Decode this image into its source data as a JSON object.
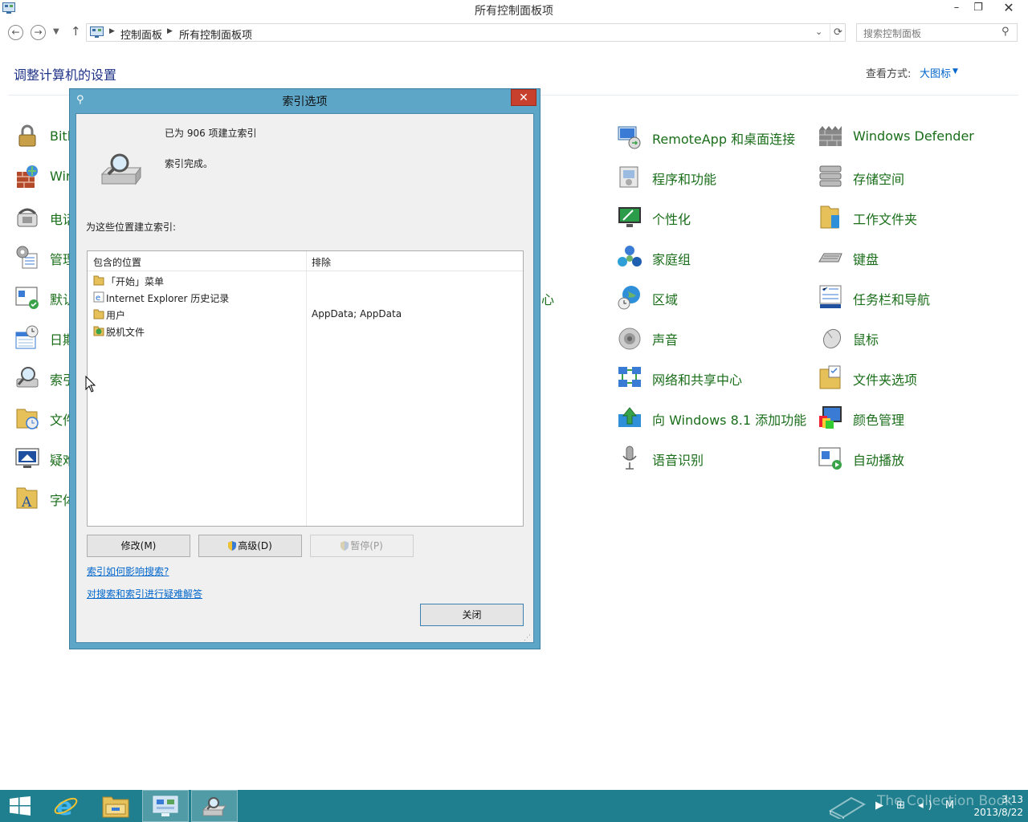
{
  "window": {
    "title": "所有控制面板项",
    "minimize": "–",
    "maximize": "❐",
    "close": "✕"
  },
  "nav": {
    "back": "←",
    "forward": "→",
    "recent": "▼",
    "up": "↑",
    "breadcrumb": [
      "控制面板",
      "所有控制面板项"
    ],
    "refresh": "⟳",
    "search_placeholder": "搜索控制面板"
  },
  "page": {
    "heading": "调整计算机的设置",
    "view_by_label": "查看方式:",
    "view_by_value": "大图标"
  },
  "left_column_partial": [
    "Bitl",
    "Wir",
    "电话",
    "管理",
    "默认",
    "日期",
    "索引",
    "文件",
    "疑难",
    "字体"
  ],
  "middle_partial": "心",
  "col3_items": [
    "RemoteApp 和桌面连接",
    "程序和功能",
    "个性化",
    "家庭组",
    "区域",
    "声音",
    "网络和共享中心",
    "向 Windows 8.1 添加功能",
    "语音识别"
  ],
  "col4_items": [
    "Windows Defender",
    "存储空间",
    "工作文件夹",
    "键盘",
    "任务栏和导航",
    "鼠标",
    "文件夹选项",
    "颜色管理",
    "自动播放"
  ],
  "dialog": {
    "title": "索引选项",
    "close": "✕",
    "indexed_count": "已为 906 项建立索引",
    "status": "索引完成。",
    "locations_label": "为这些位置建立索引:",
    "columns": {
      "included": "包含的位置",
      "excluded": "排除"
    },
    "rows": [
      {
        "location": "「开始」菜单",
        "exclude": ""
      },
      {
        "location": "Internet Explorer 历史记录",
        "exclude": ""
      },
      {
        "location": "用户",
        "exclude": "AppData; AppData"
      },
      {
        "location": "脱机文件",
        "exclude": ""
      }
    ],
    "buttons": {
      "modify": "修改(M)",
      "advanced": "高级(D)",
      "pause": "暂停(P)",
      "close": "关闭"
    },
    "links": {
      "how_affects": "索引如何影响搜索?",
      "troubleshoot": "对搜索和索引进行疑难解答"
    }
  },
  "taskbar": {
    "watermark": "The Collection Book",
    "tray": "▶ ⊞ ◂) M",
    "time": "3:13",
    "date": "2013/8/22"
  }
}
